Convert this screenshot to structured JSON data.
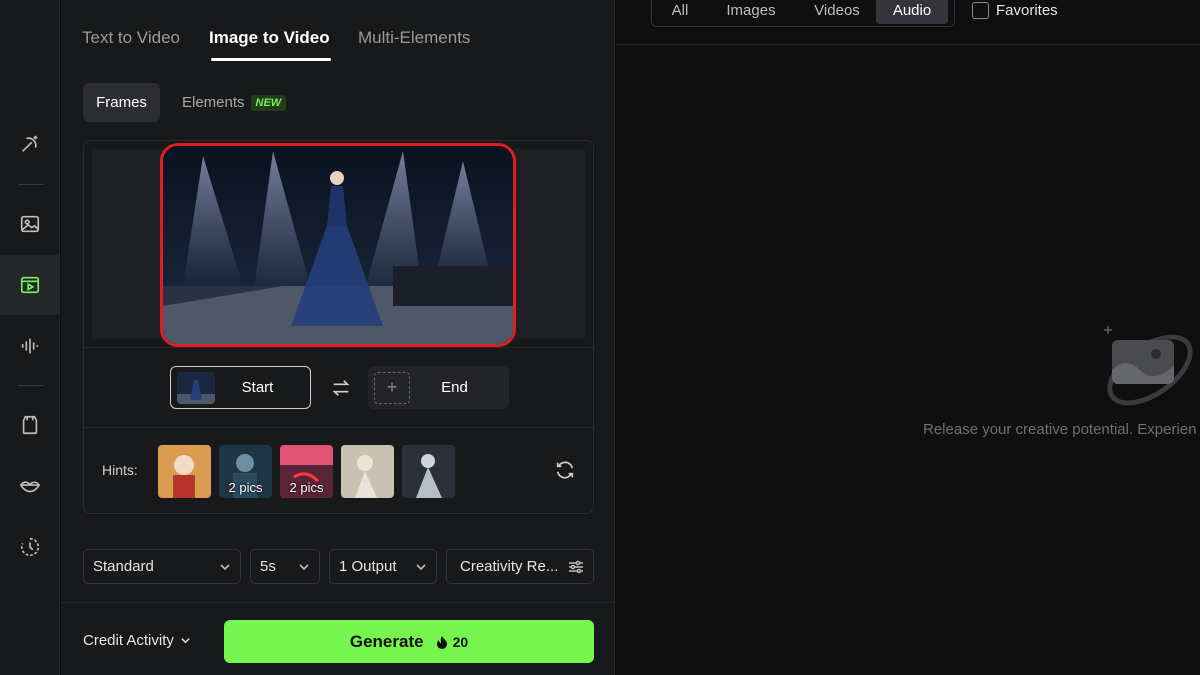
{
  "mode_tabs": [
    "Text to Video",
    "Image to Video",
    "Multi-Elements"
  ],
  "sub_tabs": {
    "frames": "Frames",
    "elements": "Elements",
    "new_badge": "NEW"
  },
  "frames": {
    "start": "Start",
    "end": "End"
  },
  "hints": {
    "label": "Hints:",
    "badge_2": "2 pics",
    "badge_3": "2 pics"
  },
  "options": {
    "quality": "Standard",
    "duration": "5s",
    "outputs": "1 Output",
    "creativity": "Creativity Re..."
  },
  "footer": {
    "credit": "Credit Activity",
    "generate": "Generate",
    "cost": "20"
  },
  "filters": [
    "All",
    "Images",
    "Videos",
    "Audio"
  ],
  "favorites": "Favorites",
  "empty_text": "Release your creative potential. Experien",
  "colors": {
    "accent": "#76f54f",
    "highlight_border": "#e01e1e",
    "background": "#0f0f10",
    "panel": "#18191b"
  },
  "icons": [
    "magic-icon",
    "image-icon",
    "video-icon",
    "audio-icon",
    "avatar-icon",
    "lips-icon",
    "history-icon",
    "swap-icon",
    "refresh-icon",
    "flame-icon",
    "chevron-down-icon",
    "settings-sliders-icon",
    "plus-icon",
    "planet-icon"
  ]
}
